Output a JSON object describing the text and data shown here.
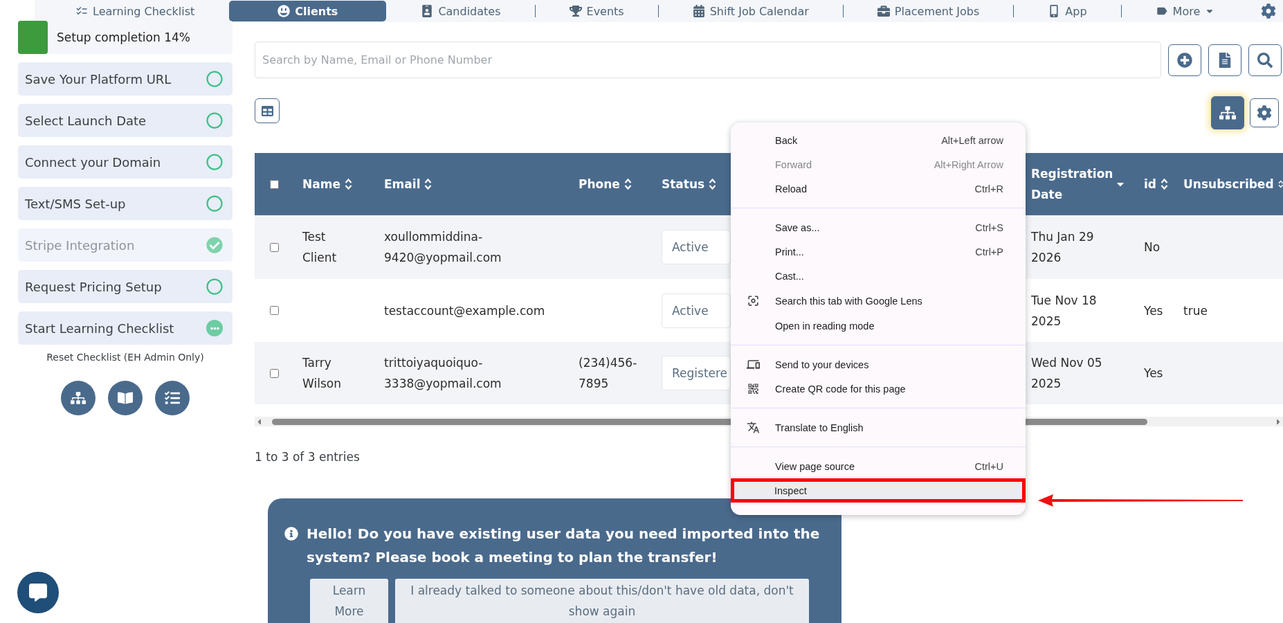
{
  "nav": {
    "items": [
      {
        "label": "Learning Checklist",
        "selected": false,
        "dropdown": false
      },
      {
        "label": "Clients",
        "selected": true,
        "dropdown": false
      },
      {
        "label": "Candidates",
        "selected": false,
        "dropdown": false
      },
      {
        "label": "Events",
        "selected": false,
        "dropdown": false
      },
      {
        "label": "Shift Job Calendar",
        "selected": false,
        "dropdown": false
      },
      {
        "label": "Placement Jobs",
        "selected": false,
        "dropdown": false
      },
      {
        "label": "App",
        "selected": false,
        "dropdown": false
      },
      {
        "label": "More",
        "selected": false,
        "dropdown": true
      }
    ]
  },
  "sidebar": {
    "progress": {
      "label": "Setup completion 14%",
      "level": 0.14
    },
    "items": [
      {
        "label": "Save Your Platform URL",
        "kind": "todo"
      },
      {
        "label": "Select Launch Date",
        "kind": "todo"
      },
      {
        "label": "Connect your Domain",
        "kind": "todo"
      },
      {
        "label": "Text/SMS Set-up",
        "kind": "todo"
      },
      {
        "label": "Stripe Integration",
        "kind": "done"
      },
      {
        "label": "Request Pricing Setup",
        "kind": "todo"
      },
      {
        "label": "Start Learning Checklist",
        "kind": "pending"
      }
    ],
    "reset_link": "Reset Checklist (EH Admin Only)"
  },
  "search": {
    "placeholder": "Search by Name, Email or Phone Number"
  },
  "table": {
    "select_all": {
      "checked": false
    },
    "columns": [
      {
        "label": "Name",
        "sorted": false
      },
      {
        "label": "Email",
        "sorted": false
      },
      {
        "label": "Phone",
        "sorted": false
      },
      {
        "label": "Status",
        "sorted": false
      },
      {
        "label": "Registration Date",
        "sorted": true
      },
      {
        "label": "id",
        "sorted": false
      },
      {
        "label": "Unsubscribed",
        "sorted": false
      }
    ],
    "rows": [
      {
        "checked": false,
        "cells": [
          "Test Client",
          "xoullommiddina-9420@yopmail.com",
          "",
          "Active",
          "Thu Jan 29 2026",
          "No",
          ""
        ]
      },
      {
        "checked": false,
        "cells": [
          "",
          "testaccount@example.com",
          "",
          "Active",
          "Tue Nov 18 2025",
          "Yes",
          "true"
        ]
      },
      {
        "checked": false,
        "cells": [
          "Tarry Wilson",
          "trittoiyaquoiquo-3338@yopmail.com",
          "(234)456-7895",
          "Registere",
          "Wed Nov 05 2025",
          "Yes",
          ""
        ]
      }
    ],
    "summary": "1 to 3 of 3 entries"
  },
  "context_menu": {
    "sections": [
      [
        {
          "label": "Back",
          "shortcut": "Alt+Left arrow",
          "disabled": false,
          "highlighted": false
        },
        {
          "label": "Forward",
          "shortcut": "Alt+Right Arrow",
          "disabled": true,
          "highlighted": false
        },
        {
          "label": "Reload",
          "shortcut": "Ctrl+R",
          "disabled": false,
          "highlighted": false
        }
      ],
      [
        {
          "label": "Save as...",
          "shortcut": "Ctrl+S",
          "disabled": false,
          "highlighted": false
        },
        {
          "label": "Print...",
          "shortcut": "Ctrl+P",
          "disabled": false,
          "highlighted": false
        },
        {
          "label": "Cast...",
          "disabled": false,
          "highlighted": false
        },
        {
          "label": "Search this tab with Google Lens",
          "disabled": false,
          "highlighted": false
        },
        {
          "label": "Open in reading mode",
          "disabled": false,
          "highlighted": false
        }
      ],
      [
        {
          "label": "Send to your devices",
          "disabled": false,
          "highlighted": false
        },
        {
          "label": "Create QR code for this page",
          "disabled": false,
          "highlighted": false
        }
      ],
      [
        {
          "label": "Translate to English",
          "disabled": false,
          "highlighted": false
        }
      ],
      [
        {
          "label": "View page source",
          "shortcut": "Ctrl+U",
          "disabled": false,
          "highlighted": false
        },
        {
          "label": "Inspect",
          "disabled": false,
          "highlighted": true
        }
      ]
    ]
  },
  "banner": {
    "message": "Hello! Do you have existing user data you need imported into the system? Please book a meeting to plan the transfer!",
    "buttons": [
      "Learn More",
      "I already talked to someone about this/don't have old data, don't show again"
    ]
  }
}
